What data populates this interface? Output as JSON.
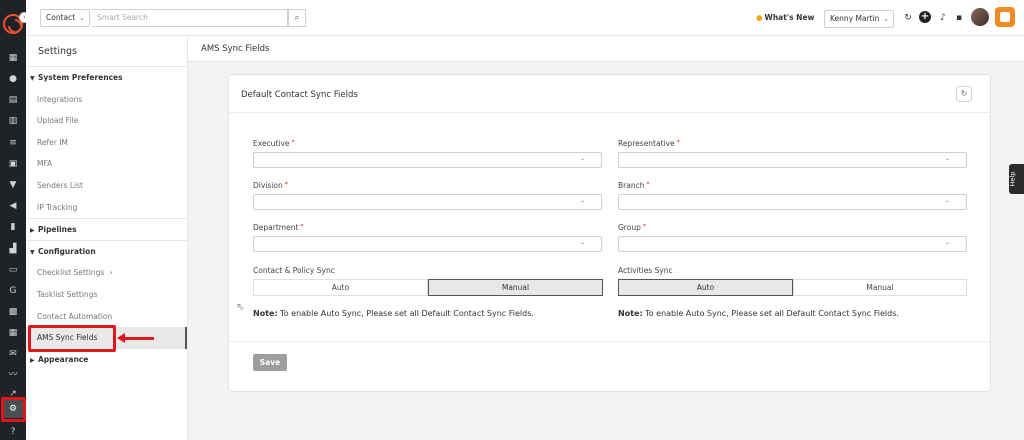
{
  "topbar": {
    "module_select": "Contact",
    "search_placeholder": "Smart Search",
    "whats_new": "What's New",
    "user_select": "Kenny Martin"
  },
  "sidebar": {
    "title": "Settings",
    "sections": {
      "system": "System Preferences",
      "pipelines": "Pipelines",
      "configuration": "Configuration",
      "appearance": "Appearance"
    },
    "items": {
      "integrations": "Integrations",
      "upload_file": "Upload File",
      "refer_im": "Refer IM",
      "mfa": "MFA",
      "senders_list": "Senders List",
      "ip_tracking": "IP Tracking",
      "checklist_settings": "Checklist Settings",
      "tasklist_settings": "Tasklist Settings",
      "contact_automation": "Contact Automation",
      "ams_sync_fields": "AMS Sync Fields"
    }
  },
  "main": {
    "page_title": "AMS Sync Fields",
    "card_title": "Default Contact Sync Fields",
    "fields": {
      "executive": "Executive",
      "representative": "Representative",
      "division": "Division",
      "branch": "Branch",
      "department": "Department",
      "group": "Group"
    },
    "required_mark": "*",
    "contact_policy_sync": {
      "label": "Contact & Policy Sync",
      "auto": "Auto",
      "manual": "Manual",
      "selected": "Manual"
    },
    "activities_sync": {
      "label": "Activities Sync",
      "auto": "Auto",
      "manual": "Manual",
      "selected": "Auto"
    },
    "note_label": "Note:",
    "note_text": " To enable Auto Sync, Please set all Default Contact Sync Fields.",
    "save_label": "Save"
  },
  "help_tab": "Help",
  "colors": {
    "annotation_red": "#e0161b",
    "rail_bg": "#1f2226",
    "brand_orange": "#f08a24"
  }
}
